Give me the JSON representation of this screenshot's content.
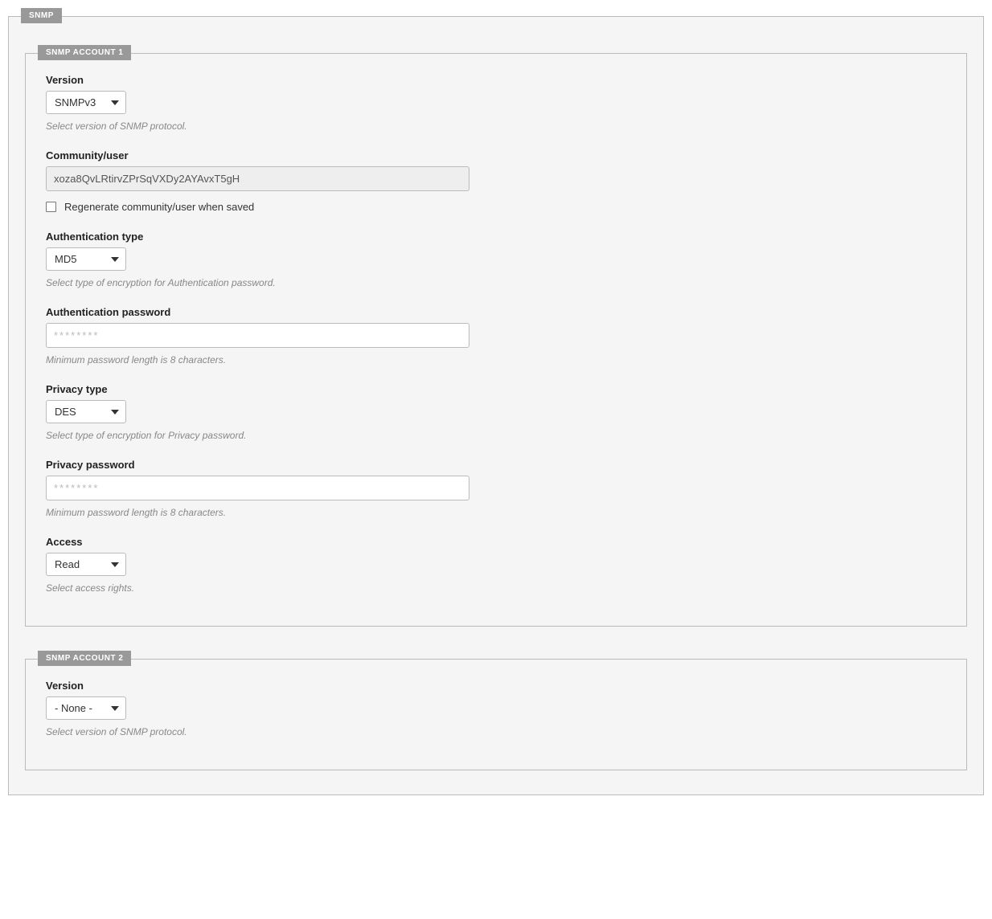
{
  "outer_legend": "SNMP",
  "account1": {
    "legend": "SNMP ACCOUNT 1",
    "version": {
      "label": "Version",
      "value": "SNMPv3",
      "helper": "Select version of SNMP protocol."
    },
    "community": {
      "label": "Community/user",
      "value": "xoza8QvLRtirvZPrSqVXDy2AYAvxT5gH",
      "regenerate_label": "Regenerate community/user when saved"
    },
    "auth_type": {
      "label": "Authentication type",
      "value": "MD5",
      "helper": "Select type of encryption for Authentication password."
    },
    "auth_password": {
      "label": "Authentication password",
      "placeholder": "********",
      "helper": "Minimum password length is 8 characters."
    },
    "privacy_type": {
      "label": "Privacy type",
      "value": "DES",
      "helper": "Select type of encryption for Privacy password."
    },
    "privacy_password": {
      "label": "Privacy password",
      "placeholder": "********",
      "helper": "Minimum password length is 8 characters."
    },
    "access": {
      "label": "Access",
      "value": "Read",
      "helper": "Select access rights."
    }
  },
  "account2": {
    "legend": "SNMP ACCOUNT 2",
    "version": {
      "label": "Version",
      "value": "- None -",
      "helper": "Select version of SNMP protocol."
    }
  }
}
